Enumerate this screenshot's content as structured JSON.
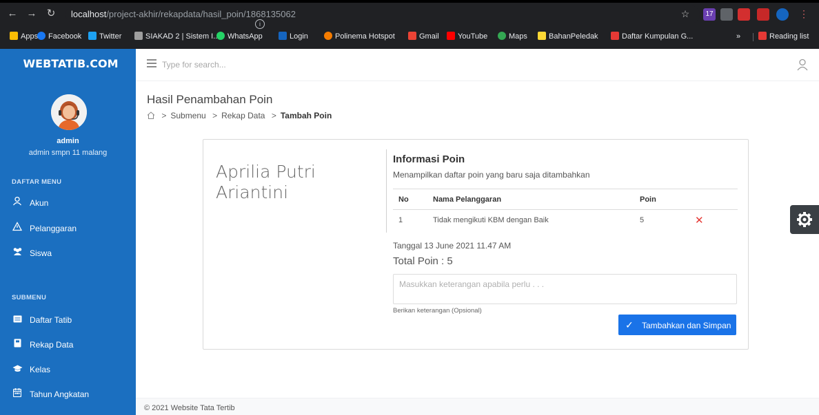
{
  "browser": {
    "url_host": "localhost",
    "url_path": "/project-akhir/rekapdata/hasil_poin/1868135062",
    "ext_badge": "17",
    "bookmarks": [
      {
        "label": "Apps",
        "color": "#fbbc04"
      },
      {
        "label": "Facebook",
        "color": "#1877f2"
      },
      {
        "label": "Twitter",
        "color": "#1da1f2"
      },
      {
        "label": "SIAKAD 2 | Sistem I...",
        "color": "#9e9e9e"
      },
      {
        "label": "WhatsApp",
        "color": "#25d366"
      },
      {
        "label": "Login",
        "color": "#1565c0"
      },
      {
        "label": "Polinema Hotspot",
        "color": "#f57c00"
      },
      {
        "label": "Gmail",
        "color": "#ea4335"
      },
      {
        "label": "YouTube",
        "color": "#ff0000"
      },
      {
        "label": "Maps",
        "color": "#34a853"
      },
      {
        "label": "BahanPeledak",
        "color": "#fdd835"
      },
      {
        "label": "Daftar Kumpulan G...",
        "color": "#e53935"
      }
    ],
    "overflow": "»",
    "reading_list": "Reading list"
  },
  "sidebar": {
    "brand": "WEBTATIB.COM",
    "user_name": "admin",
    "user_sub": "admin smpn 11 malang",
    "section_main": "DAFTAR MENU",
    "main_items": [
      {
        "label": "Akun",
        "icon": "user-icon"
      },
      {
        "label": "Pelanggaran",
        "icon": "warning-icon"
      },
      {
        "label": "Siswa",
        "icon": "users-icon"
      }
    ],
    "section_sub": "SUBMENU",
    "sub_items": [
      {
        "label": "Daftar Tatib",
        "icon": "list-icon"
      },
      {
        "label": "Rekap Data",
        "icon": "book-icon"
      },
      {
        "label": "Kelas",
        "icon": "graduation-cap-icon"
      },
      {
        "label": "Tahun Angkatan",
        "icon": "calendar-icon"
      }
    ]
  },
  "header": {
    "search_placeholder": "Type for search..."
  },
  "page": {
    "title": "Hasil Penambahan Poin",
    "breadcrumb": [
      "Submenu",
      "Rekap Data",
      "Tambah Poin"
    ]
  },
  "card": {
    "student_line1": "Aprilia Putri",
    "student_line2": "Ariantini",
    "info_title": "Informasi Poin",
    "info_desc": "Menampilkan daftar poin yang baru saja ditambahkan",
    "table": {
      "headers": [
        "No",
        "Nama Pelanggaran",
        "Poin"
      ],
      "rows": [
        {
          "no": "1",
          "nama": "Tidak mengikuti KBM dengan Baik",
          "poin": "5"
        }
      ]
    },
    "date": "Tanggal 13 June 2021 11.47 AM",
    "total": "Total Poin : 5",
    "note_placeholder": "Masukkan keterangan apabila perlu . . .",
    "hint": "Berikan keterangan (Opsional)",
    "save_label": "Tambahkan dan Simpan"
  },
  "footer": {
    "text": "© 2021 Website Tata Tertib"
  },
  "colors": {
    "sidebar": "#1b6fc0",
    "primary": "#1a73e8",
    "danger": "#e53935"
  }
}
